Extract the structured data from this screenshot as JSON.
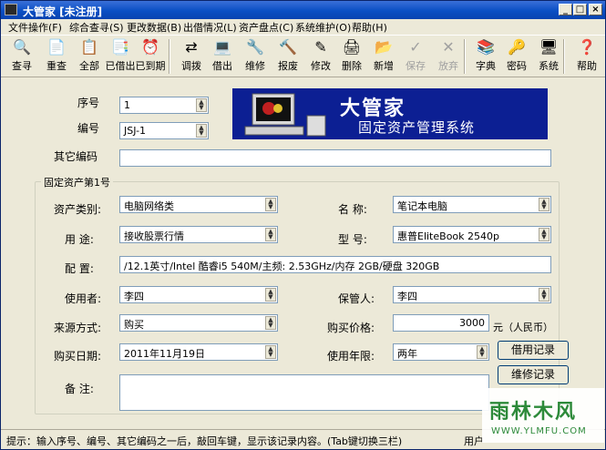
{
  "window": {
    "title": "大管家 [未注册]"
  },
  "menu": [
    "文件操作(F)",
    "综合查寻(S)",
    "更改数据(B)",
    "出借情况(L)",
    "资产盘点(C)",
    "系统维护(O)",
    "帮助(H)"
  ],
  "toolbar": [
    {
      "label": "查寻",
      "icon": "search-icon",
      "glyph": "🔍",
      "disabled": false
    },
    {
      "label": "重查",
      "icon": "requery-icon",
      "glyph": "📄",
      "disabled": false
    },
    {
      "label": "全部",
      "icon": "all-icon",
      "glyph": "📋",
      "disabled": false
    },
    {
      "label": "已借出",
      "icon": "lent-icon",
      "glyph": "📑",
      "disabled": false
    },
    {
      "label": "已到期",
      "icon": "expired-clock-icon",
      "glyph": "⏰",
      "disabled": false
    },
    {
      "label": "调拨",
      "icon": "transfer-icon",
      "glyph": "⇄",
      "disabled": false
    },
    {
      "label": "借出",
      "icon": "lend-computer-icon",
      "glyph": "💻",
      "disabled": false
    },
    {
      "label": "维修",
      "icon": "repair-icon",
      "glyph": "🔧",
      "disabled": false
    },
    {
      "label": "报废",
      "icon": "scrap-hammer-icon",
      "glyph": "🔨",
      "disabled": false
    },
    {
      "label": "修改",
      "icon": "edit-icon",
      "glyph": "✎",
      "disabled": false
    },
    {
      "label": "删除",
      "icon": "delete-icon",
      "glyph": "🖨",
      "disabled": false
    },
    {
      "label": "新增",
      "icon": "add-icon",
      "glyph": "📂",
      "disabled": false
    },
    {
      "label": "保存",
      "icon": "save-icon",
      "glyph": "✓",
      "disabled": true
    },
    {
      "label": "放弃",
      "icon": "cancel-icon",
      "glyph": "✕",
      "disabled": true
    },
    {
      "label": "字典",
      "icon": "dictionary-icon",
      "glyph": "📚",
      "disabled": false
    },
    {
      "label": "密码",
      "icon": "key-icon",
      "glyph": "🔑",
      "disabled": false
    },
    {
      "label": "系统",
      "icon": "system-icon",
      "glyph": "🖥",
      "disabled": false
    },
    {
      "label": "帮助",
      "icon": "help-icon",
      "glyph": "❓",
      "disabled": false
    }
  ],
  "form": {
    "seq_label": "序号",
    "seq_value": "1",
    "code_label": "编号",
    "code_value": "JSJ-1",
    "other_code_label": "其它编码",
    "other_code_value": "",
    "group_title": "固定资产第1号",
    "category_label": "资产类别:",
    "category_value": "电脑网络类",
    "name_label": "名    称:",
    "name_value": "笔记本电脑",
    "purpose_label": "用    途:",
    "purpose_value": "接收股票行情",
    "model_label": "型    号:",
    "model_value": "惠普EliteBook 2540p",
    "config_label": "配    置:",
    "config_value": "/12.1英寸/Intel 酷睿i5 540M/主频: 2.53GHz/内存 2GB/硬盘 320GB",
    "user_label": "使用者:",
    "user_value": "李四",
    "keeper_label": "保管人:",
    "keeper_value": "李四",
    "source_label": "来源方式:",
    "source_value": "购买",
    "price_label": "购买价格:",
    "price_value": "3000",
    "price_unit": "元（人民币）",
    "date_label": "购买日期:",
    "date_value": "2011年11月19日",
    "life_label": "使用年限:",
    "life_value": "两年",
    "note_label": "备    注:",
    "note_value": "",
    "borrow_record_btn": "借用记录",
    "repair_record_btn": "维修记录"
  },
  "banner": {
    "title": "大管家",
    "subtitle": "固定资产管理系统"
  },
  "status": {
    "hint": "提示：输入序号、编号、其它编码之一后，敲回车键，显示该记录内容。(Tab键切换三栏)",
    "user": "用户"
  },
  "watermark": {
    "brand": "雨林木风",
    "url": "WWW.YLMFU.COM"
  }
}
